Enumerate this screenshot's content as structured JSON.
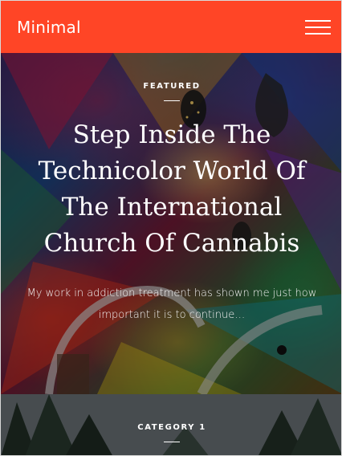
{
  "header": {
    "brand": "Minimal",
    "menu_icon": "hamburger-menu-icon",
    "background_color": "#ff4526"
  },
  "featured_post": {
    "kicker": "FEATURED",
    "title": "Step Inside The Technicolor World Of The International Church Of Cannabis",
    "excerpt": "My work in addiction treatment has shown me just how important it is to continue…"
  },
  "next_post": {
    "kicker": "CATEGORY 1"
  }
}
